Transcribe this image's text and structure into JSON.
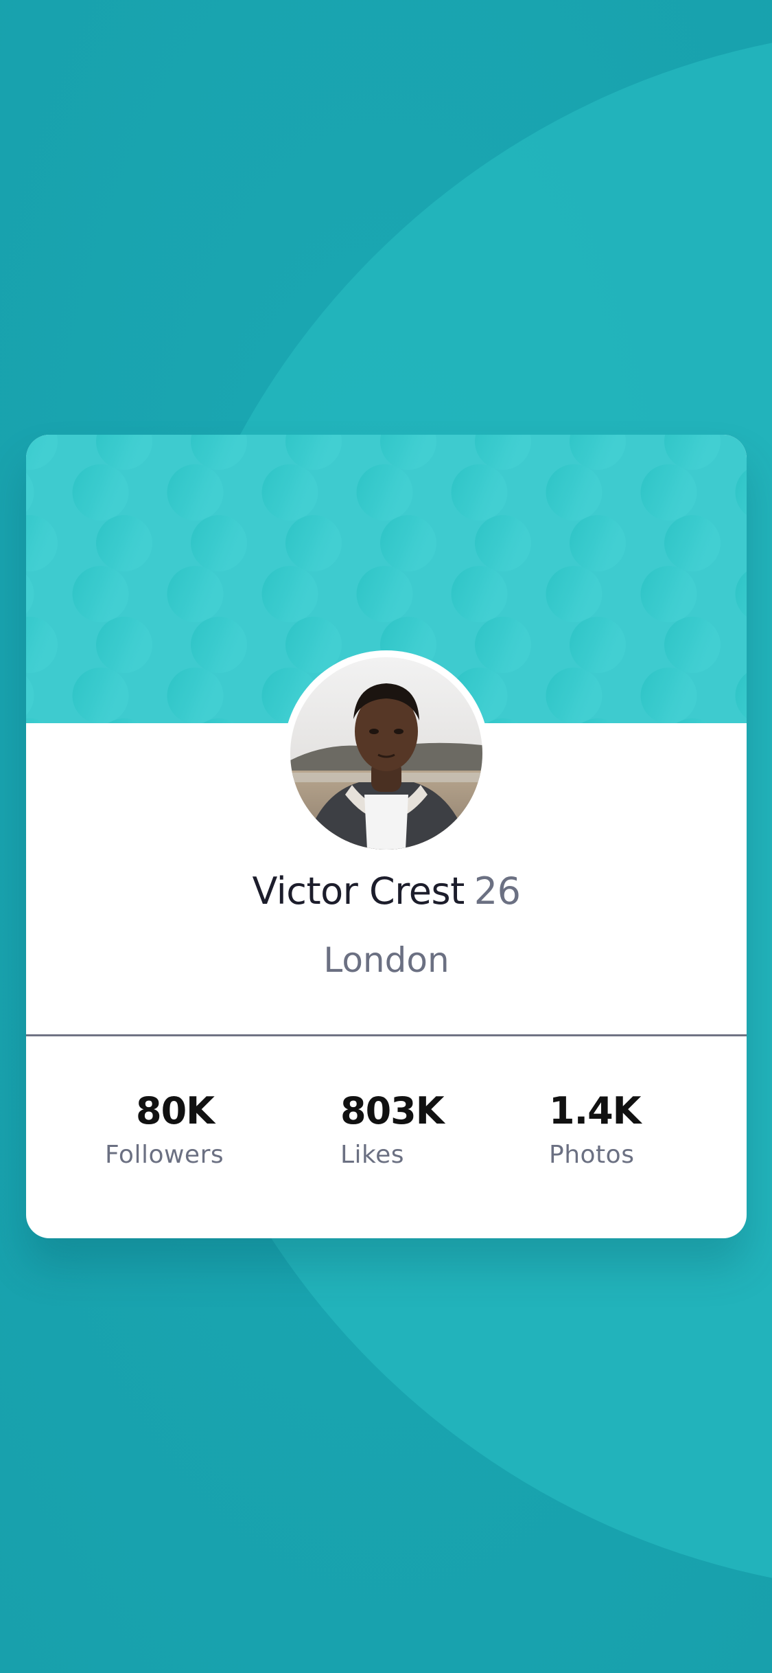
{
  "colors": {
    "background": "#19a2ae",
    "header": "#3fcfd3",
    "card": "#ffffff",
    "muted_text": "#6b7082",
    "divider": "#6f7384"
  },
  "profile": {
    "name": "Victor Crest",
    "age": "26",
    "city": "London",
    "avatar_icon": "profile-photo"
  },
  "stats": [
    {
      "value": "80K",
      "label": "Followers"
    },
    {
      "value": "803K",
      "label": "Likes"
    },
    {
      "value": "1.4K",
      "label": "Photos"
    }
  ]
}
